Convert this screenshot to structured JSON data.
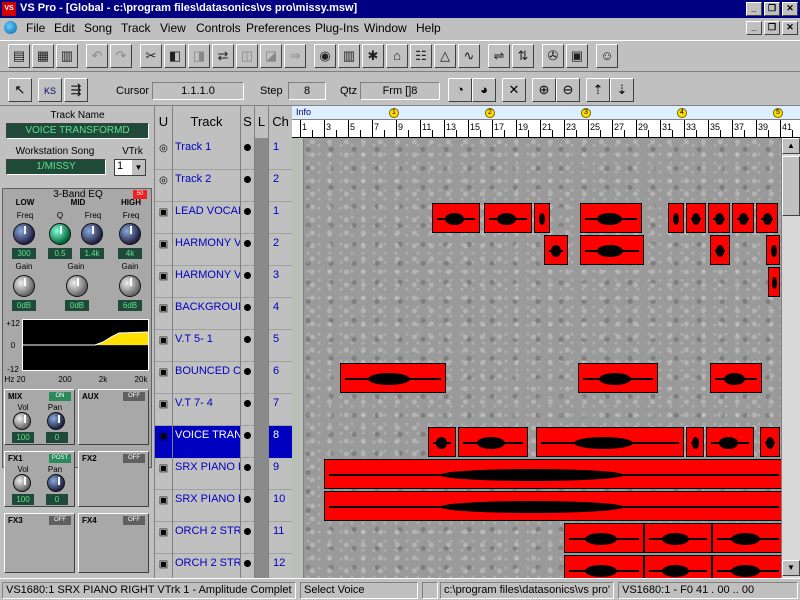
{
  "window": {
    "title": "VS Pro - [Global - c:\\program files\\datasonics\\vs pro\\missy.msw]",
    "app_icon_text": "VS"
  },
  "menu": [
    "File",
    "Edit",
    "Song",
    "Track",
    "View",
    "Controls",
    "Preferences",
    "Plug-Ins",
    "Window",
    "Help"
  ],
  "toolbar2": {
    "cursor_label": "Cursor",
    "cursor_value": "1.1.1.0",
    "step_label": "Step",
    "step_value": "8",
    "qtz_label": "Qtz",
    "qtz_value": "Frm []8",
    "ks_label": "KS"
  },
  "leftpanel": {
    "track_name_label": "Track Name",
    "track_name_value": "VOICE TRANSFORMD",
    "workstation_song_label": "Workstation Song",
    "workstation_song_value": "1/MISSY",
    "vtrk_label": "VTrk",
    "vtrk_value": "1",
    "eq": {
      "title": "3-Band EQ",
      "badge": "50",
      "bands": [
        "LOW",
        "MID",
        "HIGH"
      ],
      "freq_label": "Freq",
      "q_label": "Q",
      "gain_label": "Gain",
      "low_freq": "300",
      "mid_q": "0.5",
      "mid_freq": "1.4k",
      "high_freq": "4k",
      "low_gain": "0dB",
      "mid_gain": "0dB",
      "high_gain": "6dB",
      "graph_y_top": "+12",
      "graph_y_mid": "0",
      "graph_y_bot": "-12",
      "graph_x": [
        "Hz 20",
        "200",
        "2k",
        "20k"
      ]
    },
    "mix": {
      "label": "MIX",
      "state": "ON",
      "vol_label": "Vol",
      "pan_label": "Pan",
      "vol": "100",
      "pan": "0"
    },
    "aux": {
      "label": "AUX",
      "state": "OFF"
    },
    "fx1": {
      "label": "FX1",
      "state": "POST",
      "vol_label": "Vol",
      "pan_label": "Pan",
      "vol": "100",
      "pan": "0"
    },
    "fx2": {
      "label": "FX2",
      "state": "OFF"
    },
    "fx3": {
      "label": "FX3",
      "state": "OFF"
    },
    "fx4": {
      "label": "FX4",
      "state": "OFF"
    }
  },
  "track_table": {
    "headers": {
      "u": "U",
      "track": "Track",
      "s": "S",
      "l": "L",
      "ch": "Ch"
    },
    "rows": [
      {
        "name": "Track 1",
        "ch": "1"
      },
      {
        "name": "Track 2",
        "ch": "2"
      },
      {
        "name": "LEAD VOCAL",
        "ch": "1"
      },
      {
        "name": "HARMONY V",
        "ch": "2"
      },
      {
        "name": "HARMONY V",
        "ch": "3"
      },
      {
        "name": "BACKGROUN",
        "ch": "4"
      },
      {
        "name": "V.T 5- 1",
        "ch": "5"
      },
      {
        "name": "BOUNCED C",
        "ch": "6"
      },
      {
        "name": "V.T 7- 4",
        "ch": "7"
      },
      {
        "name": "VOICE TRAN",
        "ch": "8",
        "selected": true
      },
      {
        "name": "SRX PIANO L",
        "ch": "9"
      },
      {
        "name": "SRX PIANO R",
        "ch": "10"
      },
      {
        "name": "ORCH 2 STR",
        "ch": "11"
      },
      {
        "name": "ORCH 2 STR",
        "ch": "12"
      }
    ]
  },
  "ruler": {
    "info_label": "Info",
    "markers": [
      "1",
      "2",
      "3",
      "4",
      "5"
    ],
    "ticks": [
      "1",
      "3",
      "5",
      "7",
      "9",
      "11",
      "13",
      "15",
      "17",
      "19",
      "21",
      "23",
      "25",
      "27",
      "29",
      "31",
      "33",
      "35",
      "37",
      "39",
      "41"
    ]
  },
  "status": {
    "left": "VS1680:1 SRX PIANO RIGHT  VTrk 1 - Amplitude Complet",
    "mode": "Select Voice",
    "path": "c:\\program files\\datasonics\\vs pro'",
    "device": "VS1680:1  -  F0 41 . 00 .. 00"
  },
  "colors": {
    "titlebar": "#000080",
    "clip": "#ff0000",
    "selected_row": "#0000c0",
    "lcd_text": "#5fe08a"
  }
}
